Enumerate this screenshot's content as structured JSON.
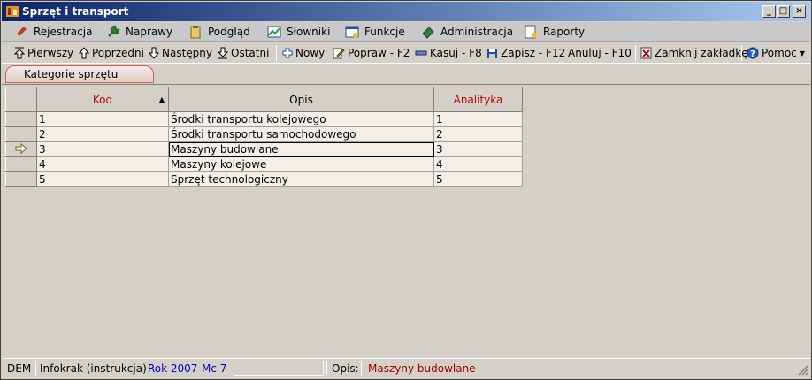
{
  "window": {
    "title": "Sprzęt i transport"
  },
  "menu": [
    "Rejestracja",
    "Naprawy",
    "Podgląd",
    "Słowniki",
    "Funkcje",
    "Administracja",
    "Raporty"
  ],
  "toolbar": {
    "first": "Pierwszy",
    "prev": "Poprzedni",
    "next": "Następny",
    "last": "Ostatni",
    "new": "Nowy",
    "edit": "Popraw - F2",
    "delete": "Kasuj - F8",
    "save": "Zapisz - F12",
    "cancel": "Anuluj - F10",
    "close_tab": "Zamknij zakładkę",
    "help": "Pomoc"
  },
  "tab": {
    "label": "Kategorie sprzętu"
  },
  "grid": {
    "columns": {
      "kod": "Kod",
      "opis": "Opis",
      "analityka": "Analityka"
    },
    "rows": [
      {
        "kod": "1",
        "opis": "Środki transportu kolejowego",
        "analityka": "1"
      },
      {
        "kod": "2",
        "opis": "Środki transportu samochodowego",
        "analityka": "2"
      },
      {
        "kod": "3",
        "opis": "Maszyny budowlane",
        "analityka": "3"
      },
      {
        "kod": "4",
        "opis": "Maszyny kolejowe",
        "analityka": "4"
      },
      {
        "kod": "5",
        "opis": "Sprzęt technologiczny",
        "analityka": "5"
      }
    ]
  },
  "status": {
    "db": "DEM",
    "user": "Infokrak (instrukcja)",
    "year": "Rok 2007",
    "month": "Mc 7",
    "opis_label": "Opis:",
    "opis_value": "Maszyny budowlane"
  },
  "colors": {
    "title_start": "#0a246a",
    "title_end": "#a6caf0",
    "required_header": "#c00000",
    "status_blue": "#0000c8"
  }
}
